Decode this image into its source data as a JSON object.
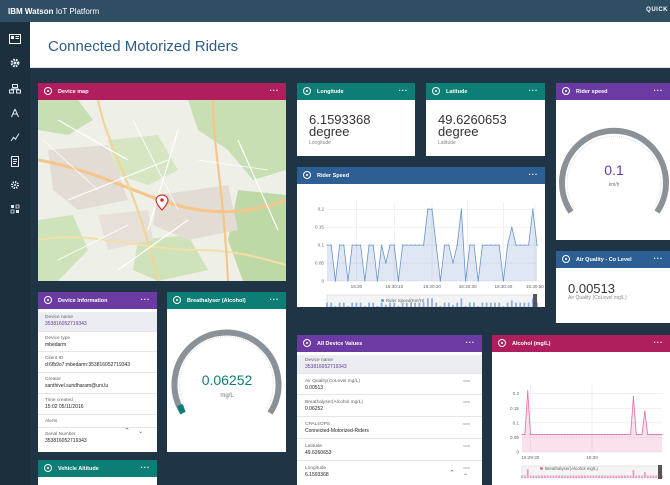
{
  "topbar": {
    "brand_bold": "IBM Watson",
    "brand_rest": " IoT Platform",
    "quick": "QUICK"
  },
  "sidenav": {
    "icons": [
      "dashboard-icon",
      "gear-icon",
      "devices-icon",
      "person-icon",
      "analytics-icon",
      "rules-icon",
      "settings-icon",
      "extensions-icon"
    ]
  },
  "header": {
    "title": "Connected Motorized Riders"
  },
  "cards": {
    "map": {
      "title": "Device map",
      "menu": "···"
    },
    "longitude": {
      "title": "Longitude",
      "menu": "···",
      "value": "6.1593368",
      "unit": "degree",
      "caption": "Longitude"
    },
    "latitude": {
      "title": "Latitude",
      "menu": "···",
      "value": "49.6260653",
      "unit": "degree",
      "caption": "Latitude"
    },
    "rider_speed_gauge": {
      "title": "Rider speed",
      "menu": "···",
      "value": "0.1",
      "unit": "km/h",
      "level": 0.01
    },
    "rider_speed_chart": {
      "title": "Rider Speed",
      "menu": "···",
      "legend": "Rider Speed(Km/H)"
    },
    "co_level": {
      "title": "Air Quality - Co Level",
      "menu": "···",
      "value": "0.00513",
      "caption": "Air Quality (CoLevel mg/L)"
    },
    "device_info": {
      "title": "Device Information",
      "menu": "···",
      "rows": [
        {
          "key": "Device name",
          "value": "353816052719343"
        },
        {
          "key": "Device type",
          "value": "mbedarm"
        },
        {
          "key": "Client ID",
          "value": "d:6fb9o7:mbedarm:353816052719343"
        },
        {
          "key": "Creator",
          "value": "santhivel.sundharam@uni.lu"
        },
        {
          "key": "Time created",
          "value": "15:02 05/11/2016"
        },
        {
          "key": "Alerts",
          "value": ""
        },
        {
          "key": "Serial Number",
          "value": "353816052719343"
        }
      ]
    },
    "breathalyser": {
      "title": "Breathalyser (Alcohol)",
      "menu": "···",
      "value": "0.06252",
      "unit": "mg/L",
      "level": 0.05
    },
    "vehicle_altitude": {
      "title": "Vehicle Altitude",
      "menu": "···"
    },
    "all_values": {
      "title": "All Device Values",
      "menu": "···",
      "rows": [
        {
          "key": "Device name",
          "value": "353816052719343",
          "now": ""
        },
        {
          "key": "Air Quality(CoLevel mg/L)",
          "value": "0.00513",
          "now": "now"
        },
        {
          "key": "Breathalyser(Alcohol mg/L)",
          "value": "0.06252",
          "now": "now"
        },
        {
          "key": "CPAL4OPS",
          "value": "Connected-Motorized-Riders",
          "now": "now"
        },
        {
          "key": "Latitude",
          "value": "49.6260653",
          "now": "now"
        },
        {
          "key": "Longitude",
          "value": "6.1593368",
          "now": "now"
        }
      ]
    },
    "alcohol": {
      "title": "Alcohol (mg/L)",
      "menu": "···",
      "legend": "Breathalyser(Alcohol mg/L)"
    }
  },
  "chart_data": [
    {
      "type": "area",
      "title": "Rider Speed",
      "series": [
        {
          "name": "Rider Speed(Km/H)",
          "values": [
            0.1,
            0.1,
            0,
            0.1,
            0.1,
            0,
            0.1,
            0.1,
            0.1,
            0,
            0.1,
            0.1,
            0,
            0.1,
            0.05,
            0.1,
            0.1,
            0,
            0.1,
            0.1,
            0.1,
            0.1,
            0.1,
            0.1,
            0.2,
            0.2,
            0.1,
            0,
            0.1,
            0.1,
            0.05,
            0.1,
            0.2,
            0,
            0.1,
            0.1,
            0,
            0.1,
            0.1,
            0.1,
            0.1,
            0.1,
            0,
            0.1,
            0.15,
            0.1,
            0.1,
            0.1,
            0.1,
            0.2,
            0.1
          ]
        }
      ],
      "x_ticks": [
        "16:30",
        "16:30:10",
        "16:30:20",
        "16:30:30",
        "16:30:40",
        "16:30:50"
      ],
      "y_ticks": [
        "0",
        "0.05",
        "0.1",
        "0.15",
        "0.2"
      ],
      "ylim": [
        0,
        0.22
      ],
      "grid": true
    },
    {
      "type": "area",
      "title": "Alcohol (mg/L)",
      "series": [
        {
          "name": "Breathalyser(Alcohol mg/L)",
          "values": [
            0.06,
            0.06,
            0.21,
            0.06,
            0.06,
            0.06,
            0.06,
            0.06,
            0.06,
            0.06,
            0.06,
            0.06,
            0.06,
            0.06,
            0.06,
            0.06,
            0.06,
            0.06,
            0.06,
            0.06,
            0.06,
            0.06,
            0.06,
            0.06,
            0.06,
            0.06,
            0.06,
            0.06,
            0.06,
            0.06,
            0.06,
            0.06,
            0.06,
            0.06,
            0.06,
            0.06,
            0.06,
            0.06,
            0.06,
            0.19,
            0.06,
            0.06,
            0.06,
            0.14,
            0.06,
            0.06,
            0.06,
            0.06,
            0.06,
            0.06
          ]
        }
      ],
      "x_ticks": [
        "16:29:30",
        "16:30"
      ],
      "y_ticks": [
        "0",
        "0.05",
        "0.1",
        "0.15",
        "0.2"
      ],
      "ylim": [
        0,
        0.23
      ],
      "grid": true
    }
  ]
}
